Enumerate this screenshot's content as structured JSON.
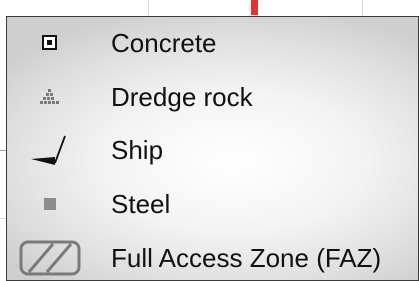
{
  "legend": {
    "items": [
      {
        "label": "Concrete",
        "icon": "concrete-square-icon"
      },
      {
        "label": "Dredge rock",
        "icon": "dredge-rock-icon"
      },
      {
        "label": "Ship",
        "icon": "ship-icon"
      },
      {
        "label": "Steel",
        "icon": "steel-square-icon"
      },
      {
        "label": "Full Access Zone (FAZ)",
        "icon": "faz-hatched-box-icon"
      }
    ]
  },
  "colors": {
    "marker_red": "#e53329",
    "steel_gray": "#8c8c8c",
    "border": "#3a3a3a"
  }
}
